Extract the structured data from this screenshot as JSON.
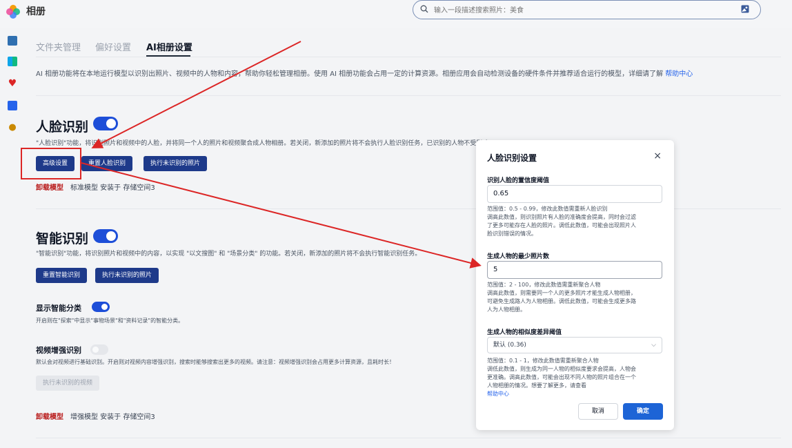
{
  "app": {
    "title": "相册"
  },
  "search": {
    "placeholder": "输入一段描述搜索照片：美食"
  },
  "tabs": [
    {
      "label": "文件夹管理",
      "active": false
    },
    {
      "label": "偏好设置",
      "active": false
    },
    {
      "label": "AI相册设置",
      "active": true
    }
  ],
  "intro": {
    "text": "AI 相册功能将在本地运行模型以识别出照片、视频中的人物和内容，帮助你轻松管理相册。使用 AI 相册功能会占用一定的计算资源。相册应用会自动检测设备的硬件条件并推荐适合运行的模型，详细请了解 ",
    "link": "帮助中心"
  },
  "face": {
    "title": "人脸识别",
    "enabled": true,
    "desc": "\"人脸识别\"功能，将识别照片和视频中的人脸，并将同一个人的照片和视频聚合成人物相册。若关闭，新添加的照片将不会执行人脸识别任务，已识别的人物不受影响。",
    "buttons": [
      "高级设置",
      "重置人脸识别",
      "执行未识别的照片"
    ],
    "uninstall": "卸载模型",
    "model_info": "标准模型 安装于 存储空间3"
  },
  "smart": {
    "title": "智能识别",
    "enabled": true,
    "desc": "\"智能识别\"功能，将识别照片和视频中的内容，以实现 \"以文搜图\" 和 \"场景分类\" 的功能。若关闭，新添加的照片将不会执行智能识别任务。",
    "buttons": [
      "重置智能识别",
      "执行未识别的照片"
    ]
  },
  "show_category": {
    "title": "显示智能分类",
    "enabled": true,
    "desc": "开启则在\"探索\"中显示\"事物场景\"和\"资料记录\"的智能分类。"
  },
  "video": {
    "title": "视频增强识别",
    "enabled": false,
    "desc": "默认会对视频进行基础识别。开启则对视频内容增强识别，搜索时能够搜索出更多的视频。请注意：视频增强识别会占用更多计算资源，且耗时长！",
    "button": "执行未识别的视频",
    "uninstall": "卸载模型",
    "model_info": "增强模型 安装于 存储空间3"
  },
  "dialog": {
    "title": "人脸识别设置",
    "close": "×",
    "confidence": {
      "label": "识别人脸的置信度阈值",
      "value": "0.65",
      "hint": [
        "范围值：0.5 - 0.99，修改此数值需重新人脸识别",
        "调高此数值，则识别照片有人脸的准确度会提高，同时会过滤",
        "了更多可能存在人脸的照片。调低此数值，可能会出现照片人",
        "脸识别错误的情况。"
      ]
    },
    "min_photos": {
      "label": "生成人物的最少照片数",
      "value": "5",
      "hint": [
        "范围值：2 - 100，修改此数值需重新聚合人物",
        "调高此数值，则需要同一个人的更多照片才能生成人物相册，",
        "可避免生成路人为人物相册。调低此数值，可能会生成更多路",
        "人为人物相册。"
      ]
    },
    "similarity": {
      "label": "生成人物的相似度差异阈值",
      "selected": "默认 (0.36)",
      "hint": [
        "范围值：0.1 - 1，修改此数值需重新聚合人物",
        "调低此数值，则生成为同一人物的相似度要求会提高，人物会",
        "更准确。调高此数值，可能会出现不同人物的照片组合在一个",
        "人物相册的情况。想要了解更多，请查看 "
      ],
      "link": "帮助中心"
    },
    "cancel": "取消",
    "ok": "确定"
  },
  "colors": {
    "accent": "#1d64d6",
    "dark_button": "#1e3a8a",
    "uninstall": "#b91c1c",
    "annotation": "#dc2626"
  }
}
